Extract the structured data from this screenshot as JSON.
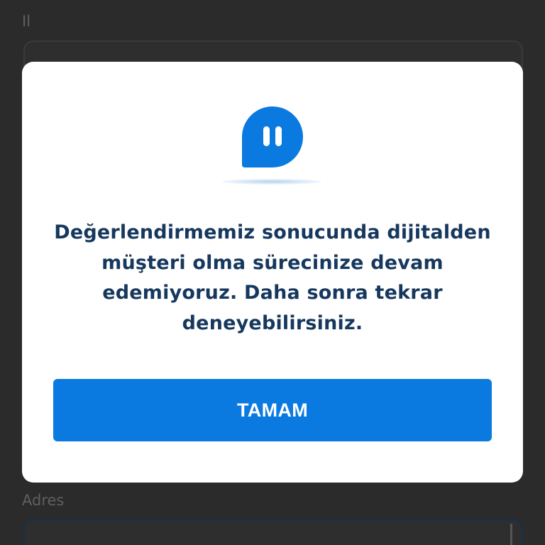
{
  "background_form": {
    "field_label_top": "Il",
    "field_label_bottom": "Adres"
  },
  "dialog": {
    "icon": "pause-chat-bubble-icon",
    "message": "Değerlendirmemiz sonucunda dijitalden müşteri olma sürecinize devam edemiyoruz. Daha sonra tekrar deneyebilirsiniz.",
    "button_label": "TAMAM"
  },
  "colors": {
    "accent": "#0a7ae0",
    "message_text": "#16385e",
    "backdrop": "#2b2b2b"
  }
}
